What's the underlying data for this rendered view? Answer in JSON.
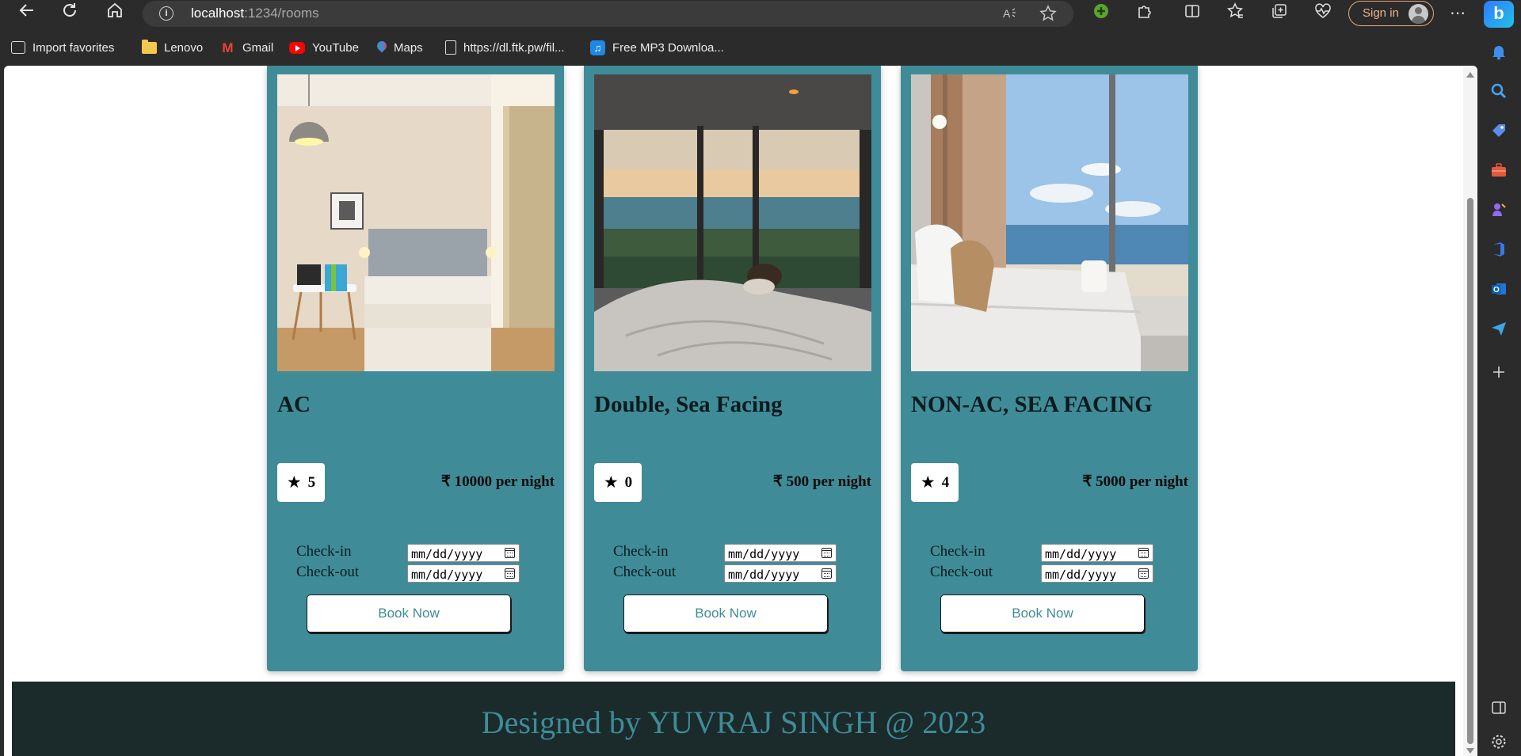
{
  "browser": {
    "url_host": "localhost",
    "url_path": ":1234/rooms",
    "signin_label": "Sign in",
    "copilot_label": "b",
    "favorites": [
      {
        "label": "Import favorites",
        "icon": "import-icon"
      },
      {
        "label": "Lenovo",
        "icon": "folder-icon"
      },
      {
        "label": "Gmail",
        "icon": "gmail-icon"
      },
      {
        "label": "YouTube",
        "icon": "youtube-icon"
      },
      {
        "label": "Maps",
        "icon": "maps-icon"
      },
      {
        "label": "https://dl.ftk.pw/fil...",
        "icon": "page-icon"
      },
      {
        "label": "Free MP3 Downloa...",
        "icon": "music-icon"
      }
    ],
    "sidebar_icons": [
      "bell-icon",
      "search-icon",
      "tag-icon",
      "toolbox-icon",
      "games-icon",
      "office-icon",
      "outlook-icon",
      "send-icon",
      "add-icon",
      "split-screen-icon",
      "settings-icon"
    ]
  },
  "rooms": [
    {
      "title": "AC",
      "rating": "5",
      "price": "₹ 10000 per night",
      "image": "hotel-room-ac-photo"
    },
    {
      "title": "Double, Sea Facing",
      "rating": "0",
      "price": "₹ 500 per night",
      "image": "hotel-room-sea-view-photo"
    },
    {
      "title": "NON-AC, SEA FACING",
      "rating": "4",
      "price": "₹ 5000 per night",
      "image": "hotel-room-beach-view-photo"
    }
  ],
  "booking": {
    "checkin_label": "Check-in",
    "checkout_label": "Check-out",
    "date_placeholder": "mm/dd/yyyy",
    "button_label": "Book Now"
  },
  "footer": {
    "text": "Designed by YUVRAJ SINGH @ 2023"
  },
  "colors": {
    "card_bg": "#3f8c98",
    "footer_bg": "#1b2a2a",
    "accent": "#3f8c98",
    "page_bg": "#ffffff",
    "chrome_bg": "#2b2b2b"
  }
}
